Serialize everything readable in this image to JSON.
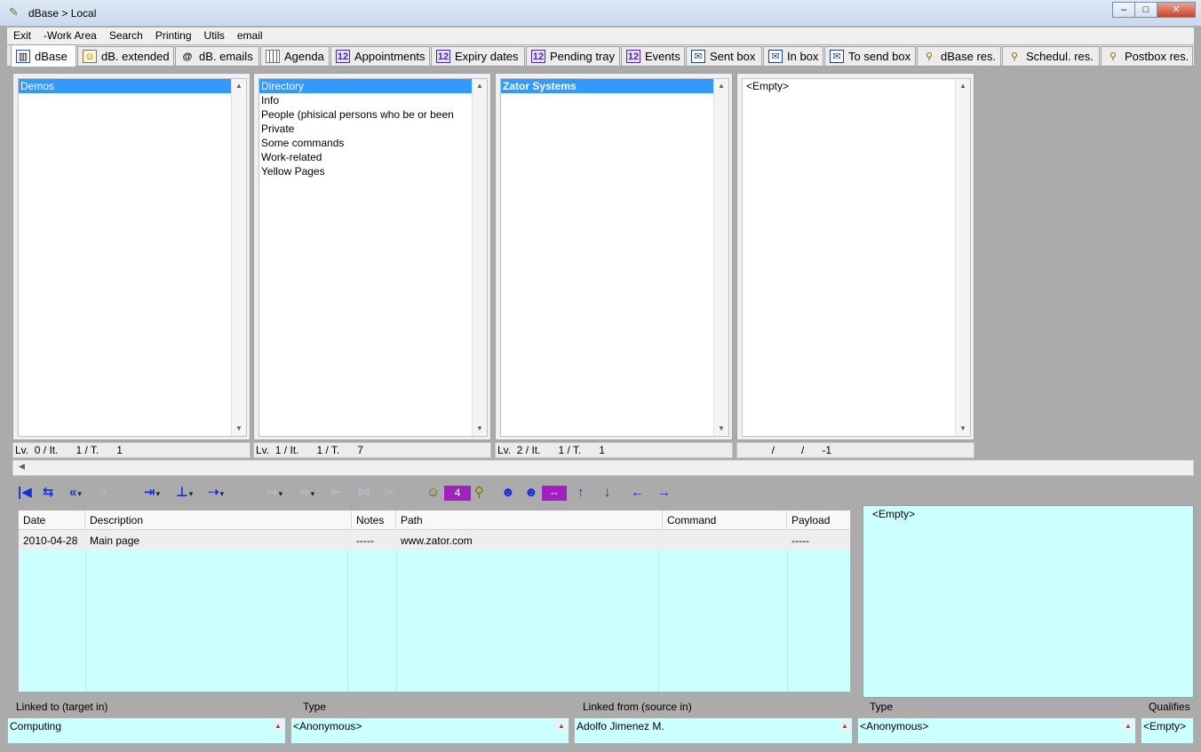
{
  "window": {
    "title": "dBase  > Local",
    "controls": {
      "minimize": "–",
      "maximize": "□",
      "close": "✕"
    }
  },
  "menu": [
    "Exit",
    "-Work Area",
    "Search",
    "Printing",
    "Utils",
    "email"
  ],
  "tabs": [
    {
      "label": "dBase",
      "icon": "book-icon",
      "active": true
    },
    {
      "label": "dB. extended",
      "icon": "contact-card-icon"
    },
    {
      "label": "dB. emails",
      "icon": "at-sign-icon"
    },
    {
      "label": "Agenda",
      "icon": "grid-calendar-icon"
    },
    {
      "label": "Appointments",
      "icon": "calendar-12-icon"
    },
    {
      "label": "Expiry dates",
      "icon": "calendar-12-icon"
    },
    {
      "label": "Pending tray",
      "icon": "calendar-12-icon"
    },
    {
      "label": "Events",
      "icon": "calendar-12-icon"
    },
    {
      "label": "Sent box",
      "icon": "envelope-icon"
    },
    {
      "label": "In box",
      "icon": "envelope-icon"
    },
    {
      "label": "To send box",
      "icon": "envelope-icon"
    },
    {
      "label": "dBase res.",
      "icon": "search-magnifier-icon"
    },
    {
      "label": "Schedul. res.",
      "icon": "search-magnifier-icon"
    },
    {
      "label": "Postbox res.",
      "icon": "search-magnifier-icon"
    }
  ],
  "columns": [
    {
      "items": [
        "Demos"
      ],
      "selected": 0,
      "status": "Lv.  0 / It.      1 / T.      1"
    },
    {
      "items": [
        "Directory",
        "Info",
        "People (phisical persons who be or been",
        "Private",
        "Some commands",
        "Work-related",
        "Yellow Pages"
      ],
      "selected": 0,
      "status": "Lv.  1 / It.      1 / T.      7"
    },
    {
      "items": [
        "Zator Systems"
      ],
      "selected": 0,
      "status": "Lv.  2 / It.      1 / T.      1"
    },
    {
      "items": [
        "<Empty>"
      ],
      "selected": -1,
      "status": "           /         /      -1"
    }
  ],
  "toolbar": {
    "count_value": "4",
    "dash_value": "--"
  },
  "grid": {
    "headers": [
      "Date",
      "Description",
      "Notes",
      "Path",
      "Command",
      "Payload"
    ],
    "rows": [
      [
        "2010-04-28",
        "Main page",
        "-----",
        "www.zator.com",
        "",
        "-----"
      ]
    ]
  },
  "memo": "<Empty>",
  "links": {
    "linked_to_label": "Linked to (target in)",
    "linked_to_value": "Computing",
    "type1_label": "Type",
    "type1_value": "<Anonymous>",
    "linked_from_label": "Linked from (source in)",
    "linked_from_value": "Adolfo Jimenez M.",
    "type2_label": "Type",
    "type2_value": "<Anonymous>",
    "qualifies_label": "Qualifies",
    "qualifies_value": "<Empty>"
  }
}
